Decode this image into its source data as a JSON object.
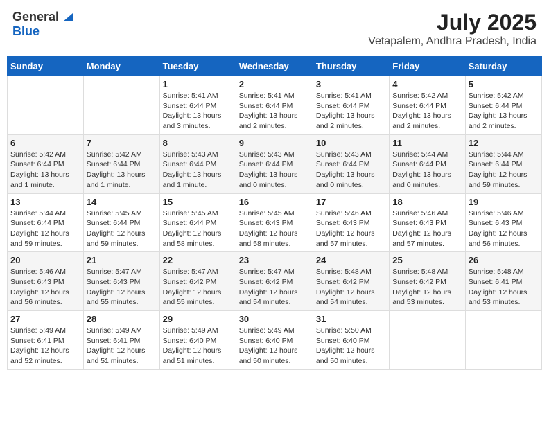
{
  "logo": {
    "general": "General",
    "blue": "Blue"
  },
  "title": "July 2025",
  "subtitle": "Vetapalem, Andhra Pradesh, India",
  "weekdays": [
    "Sunday",
    "Monday",
    "Tuesday",
    "Wednesday",
    "Thursday",
    "Friday",
    "Saturday"
  ],
  "weeks": [
    [
      {
        "day": "",
        "info": ""
      },
      {
        "day": "",
        "info": ""
      },
      {
        "day": "1",
        "info": "Sunrise: 5:41 AM\nSunset: 6:44 PM\nDaylight: 13 hours\nand 3 minutes."
      },
      {
        "day": "2",
        "info": "Sunrise: 5:41 AM\nSunset: 6:44 PM\nDaylight: 13 hours\nand 2 minutes."
      },
      {
        "day": "3",
        "info": "Sunrise: 5:41 AM\nSunset: 6:44 PM\nDaylight: 13 hours\nand 2 minutes."
      },
      {
        "day": "4",
        "info": "Sunrise: 5:42 AM\nSunset: 6:44 PM\nDaylight: 13 hours\nand 2 minutes."
      },
      {
        "day": "5",
        "info": "Sunrise: 5:42 AM\nSunset: 6:44 PM\nDaylight: 13 hours\nand 2 minutes."
      }
    ],
    [
      {
        "day": "6",
        "info": "Sunrise: 5:42 AM\nSunset: 6:44 PM\nDaylight: 13 hours\nand 1 minute."
      },
      {
        "day": "7",
        "info": "Sunrise: 5:42 AM\nSunset: 6:44 PM\nDaylight: 13 hours\nand 1 minute."
      },
      {
        "day": "8",
        "info": "Sunrise: 5:43 AM\nSunset: 6:44 PM\nDaylight: 13 hours\nand 1 minute."
      },
      {
        "day": "9",
        "info": "Sunrise: 5:43 AM\nSunset: 6:44 PM\nDaylight: 13 hours\nand 0 minutes."
      },
      {
        "day": "10",
        "info": "Sunrise: 5:43 AM\nSunset: 6:44 PM\nDaylight: 13 hours\nand 0 minutes."
      },
      {
        "day": "11",
        "info": "Sunrise: 5:44 AM\nSunset: 6:44 PM\nDaylight: 13 hours\nand 0 minutes."
      },
      {
        "day": "12",
        "info": "Sunrise: 5:44 AM\nSunset: 6:44 PM\nDaylight: 12 hours\nand 59 minutes."
      }
    ],
    [
      {
        "day": "13",
        "info": "Sunrise: 5:44 AM\nSunset: 6:44 PM\nDaylight: 12 hours\nand 59 minutes."
      },
      {
        "day": "14",
        "info": "Sunrise: 5:45 AM\nSunset: 6:44 PM\nDaylight: 12 hours\nand 59 minutes."
      },
      {
        "day": "15",
        "info": "Sunrise: 5:45 AM\nSunset: 6:44 PM\nDaylight: 12 hours\nand 58 minutes."
      },
      {
        "day": "16",
        "info": "Sunrise: 5:45 AM\nSunset: 6:43 PM\nDaylight: 12 hours\nand 58 minutes."
      },
      {
        "day": "17",
        "info": "Sunrise: 5:46 AM\nSunset: 6:43 PM\nDaylight: 12 hours\nand 57 minutes."
      },
      {
        "day": "18",
        "info": "Sunrise: 5:46 AM\nSunset: 6:43 PM\nDaylight: 12 hours\nand 57 minutes."
      },
      {
        "day": "19",
        "info": "Sunrise: 5:46 AM\nSunset: 6:43 PM\nDaylight: 12 hours\nand 56 minutes."
      }
    ],
    [
      {
        "day": "20",
        "info": "Sunrise: 5:46 AM\nSunset: 6:43 PM\nDaylight: 12 hours\nand 56 minutes."
      },
      {
        "day": "21",
        "info": "Sunrise: 5:47 AM\nSunset: 6:43 PM\nDaylight: 12 hours\nand 55 minutes."
      },
      {
        "day": "22",
        "info": "Sunrise: 5:47 AM\nSunset: 6:42 PM\nDaylight: 12 hours\nand 55 minutes."
      },
      {
        "day": "23",
        "info": "Sunrise: 5:47 AM\nSunset: 6:42 PM\nDaylight: 12 hours\nand 54 minutes."
      },
      {
        "day": "24",
        "info": "Sunrise: 5:48 AM\nSunset: 6:42 PM\nDaylight: 12 hours\nand 54 minutes."
      },
      {
        "day": "25",
        "info": "Sunrise: 5:48 AM\nSunset: 6:42 PM\nDaylight: 12 hours\nand 53 minutes."
      },
      {
        "day": "26",
        "info": "Sunrise: 5:48 AM\nSunset: 6:41 PM\nDaylight: 12 hours\nand 53 minutes."
      }
    ],
    [
      {
        "day": "27",
        "info": "Sunrise: 5:49 AM\nSunset: 6:41 PM\nDaylight: 12 hours\nand 52 minutes."
      },
      {
        "day": "28",
        "info": "Sunrise: 5:49 AM\nSunset: 6:41 PM\nDaylight: 12 hours\nand 51 minutes."
      },
      {
        "day": "29",
        "info": "Sunrise: 5:49 AM\nSunset: 6:40 PM\nDaylight: 12 hours\nand 51 minutes."
      },
      {
        "day": "30",
        "info": "Sunrise: 5:49 AM\nSunset: 6:40 PM\nDaylight: 12 hours\nand 50 minutes."
      },
      {
        "day": "31",
        "info": "Sunrise: 5:50 AM\nSunset: 6:40 PM\nDaylight: 12 hours\nand 50 minutes."
      },
      {
        "day": "",
        "info": ""
      },
      {
        "day": "",
        "info": ""
      }
    ]
  ]
}
